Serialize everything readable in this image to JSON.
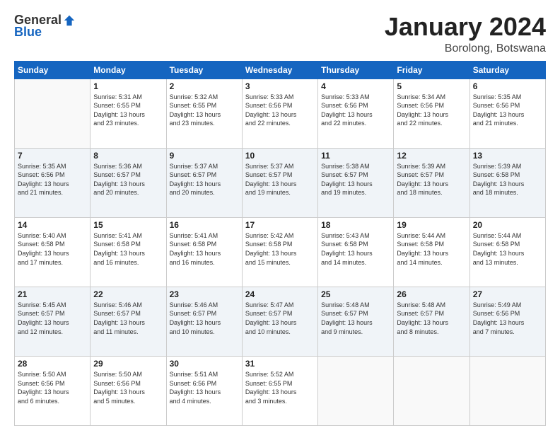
{
  "header": {
    "logo_general": "General",
    "logo_blue": "Blue",
    "month": "January 2024",
    "location": "Borolong, Botswana"
  },
  "days_of_week": [
    "Sunday",
    "Monday",
    "Tuesday",
    "Wednesday",
    "Thursday",
    "Friday",
    "Saturday"
  ],
  "weeks": [
    [
      {
        "day": "",
        "info": ""
      },
      {
        "day": "1",
        "info": "Sunrise: 5:31 AM\nSunset: 6:55 PM\nDaylight: 13 hours\nand 23 minutes."
      },
      {
        "day": "2",
        "info": "Sunrise: 5:32 AM\nSunset: 6:55 PM\nDaylight: 13 hours\nand 23 minutes."
      },
      {
        "day": "3",
        "info": "Sunrise: 5:33 AM\nSunset: 6:56 PM\nDaylight: 13 hours\nand 22 minutes."
      },
      {
        "day": "4",
        "info": "Sunrise: 5:33 AM\nSunset: 6:56 PM\nDaylight: 13 hours\nand 22 minutes."
      },
      {
        "day": "5",
        "info": "Sunrise: 5:34 AM\nSunset: 6:56 PM\nDaylight: 13 hours\nand 22 minutes."
      },
      {
        "day": "6",
        "info": "Sunrise: 5:35 AM\nSunset: 6:56 PM\nDaylight: 13 hours\nand 21 minutes."
      }
    ],
    [
      {
        "day": "7",
        "info": "Sunrise: 5:35 AM\nSunset: 6:56 PM\nDaylight: 13 hours\nand 21 minutes."
      },
      {
        "day": "8",
        "info": "Sunrise: 5:36 AM\nSunset: 6:57 PM\nDaylight: 13 hours\nand 20 minutes."
      },
      {
        "day": "9",
        "info": "Sunrise: 5:37 AM\nSunset: 6:57 PM\nDaylight: 13 hours\nand 20 minutes."
      },
      {
        "day": "10",
        "info": "Sunrise: 5:37 AM\nSunset: 6:57 PM\nDaylight: 13 hours\nand 19 minutes."
      },
      {
        "day": "11",
        "info": "Sunrise: 5:38 AM\nSunset: 6:57 PM\nDaylight: 13 hours\nand 19 minutes."
      },
      {
        "day": "12",
        "info": "Sunrise: 5:39 AM\nSunset: 6:57 PM\nDaylight: 13 hours\nand 18 minutes."
      },
      {
        "day": "13",
        "info": "Sunrise: 5:39 AM\nSunset: 6:58 PM\nDaylight: 13 hours\nand 18 minutes."
      }
    ],
    [
      {
        "day": "14",
        "info": "Sunrise: 5:40 AM\nSunset: 6:58 PM\nDaylight: 13 hours\nand 17 minutes."
      },
      {
        "day": "15",
        "info": "Sunrise: 5:41 AM\nSunset: 6:58 PM\nDaylight: 13 hours\nand 16 minutes."
      },
      {
        "day": "16",
        "info": "Sunrise: 5:41 AM\nSunset: 6:58 PM\nDaylight: 13 hours\nand 16 minutes."
      },
      {
        "day": "17",
        "info": "Sunrise: 5:42 AM\nSunset: 6:58 PM\nDaylight: 13 hours\nand 15 minutes."
      },
      {
        "day": "18",
        "info": "Sunrise: 5:43 AM\nSunset: 6:58 PM\nDaylight: 13 hours\nand 14 minutes."
      },
      {
        "day": "19",
        "info": "Sunrise: 5:44 AM\nSunset: 6:58 PM\nDaylight: 13 hours\nand 14 minutes."
      },
      {
        "day": "20",
        "info": "Sunrise: 5:44 AM\nSunset: 6:58 PM\nDaylight: 13 hours\nand 13 minutes."
      }
    ],
    [
      {
        "day": "21",
        "info": "Sunrise: 5:45 AM\nSunset: 6:57 PM\nDaylight: 13 hours\nand 12 minutes."
      },
      {
        "day": "22",
        "info": "Sunrise: 5:46 AM\nSunset: 6:57 PM\nDaylight: 13 hours\nand 11 minutes."
      },
      {
        "day": "23",
        "info": "Sunrise: 5:46 AM\nSunset: 6:57 PM\nDaylight: 13 hours\nand 10 minutes."
      },
      {
        "day": "24",
        "info": "Sunrise: 5:47 AM\nSunset: 6:57 PM\nDaylight: 13 hours\nand 10 minutes."
      },
      {
        "day": "25",
        "info": "Sunrise: 5:48 AM\nSunset: 6:57 PM\nDaylight: 13 hours\nand 9 minutes."
      },
      {
        "day": "26",
        "info": "Sunrise: 5:48 AM\nSunset: 6:57 PM\nDaylight: 13 hours\nand 8 minutes."
      },
      {
        "day": "27",
        "info": "Sunrise: 5:49 AM\nSunset: 6:56 PM\nDaylight: 13 hours\nand 7 minutes."
      }
    ],
    [
      {
        "day": "28",
        "info": "Sunrise: 5:50 AM\nSunset: 6:56 PM\nDaylight: 13 hours\nand 6 minutes."
      },
      {
        "day": "29",
        "info": "Sunrise: 5:50 AM\nSunset: 6:56 PM\nDaylight: 13 hours\nand 5 minutes."
      },
      {
        "day": "30",
        "info": "Sunrise: 5:51 AM\nSunset: 6:56 PM\nDaylight: 13 hours\nand 4 minutes."
      },
      {
        "day": "31",
        "info": "Sunrise: 5:52 AM\nSunset: 6:55 PM\nDaylight: 13 hours\nand 3 minutes."
      },
      {
        "day": "",
        "info": ""
      },
      {
        "day": "",
        "info": ""
      },
      {
        "day": "",
        "info": ""
      }
    ]
  ]
}
